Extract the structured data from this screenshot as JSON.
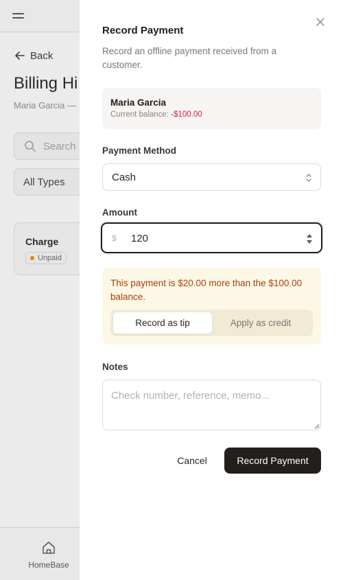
{
  "background": {
    "back_label": "Back",
    "title": "Billing Hi",
    "subtitle": "Maria Garcia —",
    "search_placeholder": "Search",
    "filter_value": "All Types",
    "card": {
      "label": "Charge",
      "status": "Unpaid",
      "status_color": "#e08a00"
    },
    "nav": {
      "home_label": "HomeBase"
    }
  },
  "dialog": {
    "title": "Record Payment",
    "description": "Record an offline payment received from a customer.",
    "customer": {
      "name": "Maria Garcia",
      "balance_label": "Current balance:",
      "balance_value": "-$100.00"
    },
    "payment_method": {
      "label": "Payment Method",
      "value": "Cash"
    },
    "amount": {
      "label": "Amount",
      "currency": "$",
      "value": "120"
    },
    "overpayment": {
      "message": "This payment is $20.00 more than the $100.00 balance.",
      "options": [
        "Record as tip",
        "Apply as credit"
      ],
      "selected": "Record as tip"
    },
    "notes": {
      "label": "Notes",
      "placeholder": "Check number, reference, memo..."
    },
    "actions": {
      "cancel": "Cancel",
      "submit": "Record Payment"
    }
  },
  "colors": {
    "primary": "#221f1c",
    "negative": "#d0213a",
    "warning_text": "#a4410f",
    "warning_bg": "#fdf8e6"
  }
}
